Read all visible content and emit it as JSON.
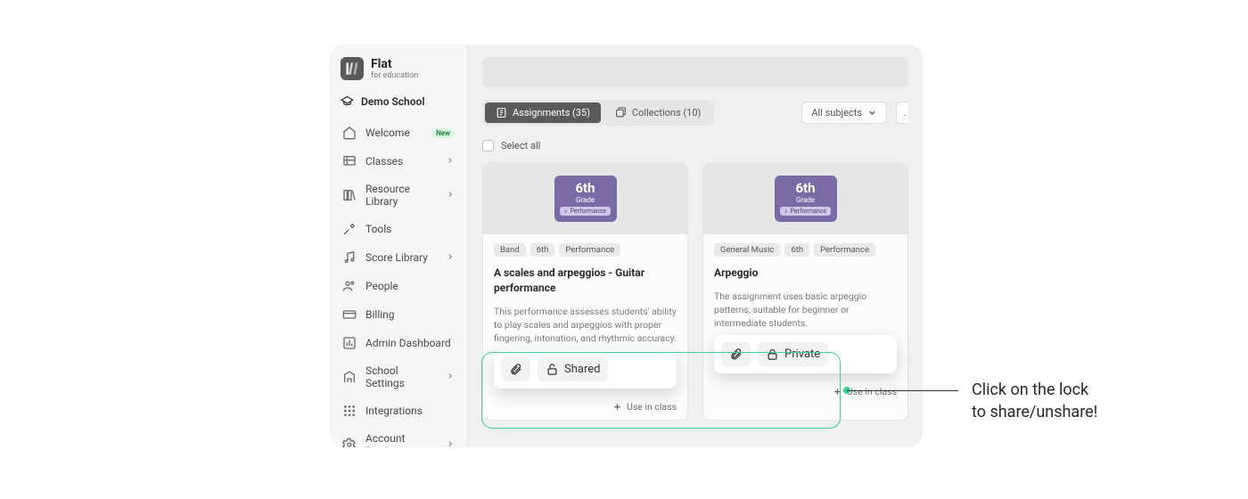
{
  "brand": {
    "name": "Flat",
    "sub": "for education"
  },
  "school": "Demo School",
  "sidebar": {
    "items": [
      {
        "label": "Welcome",
        "badge": "New",
        "chevron": false
      },
      {
        "label": "Classes",
        "chevron": true
      },
      {
        "label": "Resource Library",
        "chevron": true
      },
      {
        "label": "Tools",
        "chevron": false
      },
      {
        "label": "Score Library",
        "chevron": true
      },
      {
        "label": "People",
        "chevron": false
      },
      {
        "label": "Billing",
        "chevron": false
      },
      {
        "label": "Admin Dashboard",
        "chevron": false
      },
      {
        "label": "School Settings",
        "chevron": true
      },
      {
        "label": "Integrations",
        "chevron": false
      },
      {
        "label": "Account Settings",
        "chevron": true
      }
    ]
  },
  "tabs": {
    "assignments": "Assignments (35)",
    "collections": "Collections (10)"
  },
  "filters": {
    "subjects": "All subjects"
  },
  "select_all": "Select all",
  "grade": {
    "num": "6th",
    "word": "Grade",
    "pill": "Performance"
  },
  "cards": [
    {
      "tags": [
        "Band",
        "6th",
        "Performance"
      ],
      "title": "A scales and arpeggios - Guitar performance",
      "desc": "This performance assesses students' ability to play scales and arpeggios with proper fingering, intonation, and rhythmic accuracy.",
      "share_state": "Shared"
    },
    {
      "tags": [
        "General Music",
        "6th",
        "Performance"
      ],
      "title": "Arpeggio",
      "desc": "The assignment uses basic arpeggio patterns, suitable for beginner or intermediate students.",
      "share_state": "Private"
    }
  ],
  "use_label": "Use in class",
  "annotation": {
    "line1": "Click on the lock",
    "line2": "to share/unshare!"
  }
}
